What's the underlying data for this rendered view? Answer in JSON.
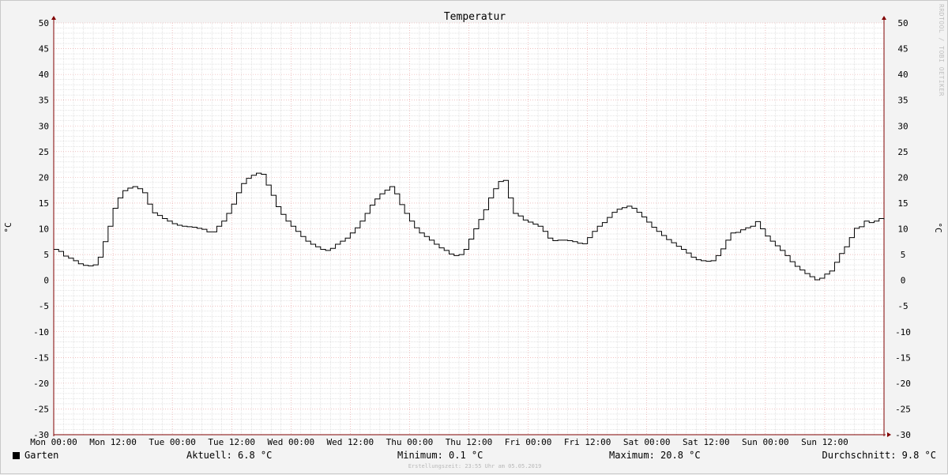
{
  "chart_data": {
    "type": "line",
    "style": "step",
    "title": "Temperatur",
    "ylabel": "°C",
    "ylim": [
      -30,
      50
    ],
    "yticks": [
      -30,
      -25,
      -20,
      -15,
      -10,
      -5,
      0,
      5,
      10,
      15,
      20,
      25,
      30,
      35,
      40,
      45,
      50
    ],
    "x_ticklabels": [
      "Mon 00:00",
      "Mon 12:00",
      "Tue 00:00",
      "Tue 12:00",
      "Wed 00:00",
      "Wed 12:00",
      "Thu 00:00",
      "Thu 12:00",
      "Fri 00:00",
      "Fri 12:00",
      "Sat 00:00",
      "Sat 12:00",
      "Sun 00:00",
      "Sun 12:00"
    ],
    "x_unit": "hours since Mon 00:00",
    "xlim": [
      0,
      168
    ],
    "grid": true,
    "series": [
      {
        "name": "Garten",
        "color": "#000000",
        "points": [
          [
            0,
            6.0
          ],
          [
            1,
            5.6
          ],
          [
            2,
            4.7
          ],
          [
            3,
            4.3
          ],
          [
            4,
            3.8
          ],
          [
            5,
            3.2
          ],
          [
            6,
            2.9
          ],
          [
            7,
            2.8
          ],
          [
            8,
            3.0
          ],
          [
            9,
            4.5
          ],
          [
            10,
            7.5
          ],
          [
            11,
            10.5
          ],
          [
            12,
            14.0
          ],
          [
            13,
            16.0
          ],
          [
            14,
            17.4
          ],
          [
            15,
            17.9
          ],
          [
            16,
            18.2
          ],
          [
            17,
            17.8
          ],
          [
            18,
            17.0
          ],
          [
            19,
            14.8
          ],
          [
            20,
            13.1
          ],
          [
            21,
            12.6
          ],
          [
            22,
            12.0
          ],
          [
            23,
            11.5
          ],
          [
            24,
            11.0
          ],
          [
            25,
            10.7
          ],
          [
            26,
            10.5
          ],
          [
            27,
            10.4
          ],
          [
            28,
            10.3
          ],
          [
            29,
            10.1
          ],
          [
            30,
            9.9
          ],
          [
            31,
            9.4
          ],
          [
            32,
            9.4
          ],
          [
            33,
            10.5
          ],
          [
            34,
            11.5
          ],
          [
            35,
            13.0
          ],
          [
            36,
            14.8
          ],
          [
            37,
            17.0
          ],
          [
            38,
            18.8
          ],
          [
            39,
            19.8
          ],
          [
            40,
            20.4
          ],
          [
            41,
            20.8
          ],
          [
            42,
            20.6
          ],
          [
            43,
            18.5
          ],
          [
            44,
            16.5
          ],
          [
            45,
            14.3
          ],
          [
            46,
            12.8
          ],
          [
            47,
            11.5
          ],
          [
            48,
            10.5
          ],
          [
            49,
            9.5
          ],
          [
            50,
            8.5
          ],
          [
            51,
            7.6
          ],
          [
            52,
            7.0
          ],
          [
            53,
            6.5
          ],
          [
            54,
            6.0
          ],
          [
            55,
            5.8
          ],
          [
            56,
            6.2
          ],
          [
            57,
            7.0
          ],
          [
            58,
            7.6
          ],
          [
            59,
            8.2
          ],
          [
            60,
            9.2
          ],
          [
            61,
            10.2
          ],
          [
            62,
            11.5
          ],
          [
            63,
            13.0
          ],
          [
            64,
            14.6
          ],
          [
            65,
            15.8
          ],
          [
            66,
            16.8
          ],
          [
            67,
            17.5
          ],
          [
            68,
            18.2
          ],
          [
            69,
            16.8
          ],
          [
            70,
            14.7
          ],
          [
            71,
            13.0
          ],
          [
            72,
            11.5
          ],
          [
            73,
            10.2
          ],
          [
            74,
            9.2
          ],
          [
            75,
            8.5
          ],
          [
            76,
            7.8
          ],
          [
            77,
            7.0
          ],
          [
            78,
            6.3
          ],
          [
            79,
            5.8
          ],
          [
            80,
            5.1
          ],
          [
            81,
            4.8
          ],
          [
            82,
            5.0
          ],
          [
            83,
            6.0
          ],
          [
            84,
            8.0
          ],
          [
            85,
            10.0
          ],
          [
            86,
            11.8
          ],
          [
            87,
            13.7
          ],
          [
            88,
            16.0
          ],
          [
            89,
            17.8
          ],
          [
            90,
            19.2
          ],
          [
            91,
            19.4
          ],
          [
            92,
            16.0
          ],
          [
            93,
            13.0
          ],
          [
            94,
            12.5
          ],
          [
            95,
            11.7
          ],
          [
            96,
            11.3
          ],
          [
            97,
            10.9
          ],
          [
            98,
            10.5
          ],
          [
            99,
            9.5
          ],
          [
            100,
            8.2
          ],
          [
            101,
            7.7
          ],
          [
            102,
            7.8
          ],
          [
            103,
            7.8
          ],
          [
            104,
            7.7
          ],
          [
            105,
            7.5
          ],
          [
            106,
            7.2
          ],
          [
            107,
            7.1
          ],
          [
            108,
            8.3
          ],
          [
            109,
            9.5
          ],
          [
            110,
            10.5
          ],
          [
            111,
            11.2
          ],
          [
            112,
            12.2
          ],
          [
            113,
            13.2
          ],
          [
            114,
            13.8
          ],
          [
            115,
            14.1
          ],
          [
            116,
            14.4
          ],
          [
            117,
            14.0
          ],
          [
            118,
            13.2
          ],
          [
            119,
            12.3
          ],
          [
            120,
            11.3
          ],
          [
            121,
            10.3
          ],
          [
            122,
            9.5
          ],
          [
            123,
            8.7
          ],
          [
            124,
            7.9
          ],
          [
            125,
            7.3
          ],
          [
            126,
            6.6
          ],
          [
            127,
            6.0
          ],
          [
            128,
            5.3
          ],
          [
            129,
            4.5
          ],
          [
            130,
            4.0
          ],
          [
            131,
            3.8
          ],
          [
            132,
            3.7
          ],
          [
            133,
            3.8
          ],
          [
            134,
            4.8
          ],
          [
            135,
            6.1
          ],
          [
            136,
            7.8
          ],
          [
            137,
            9.2
          ],
          [
            138,
            9.3
          ],
          [
            139,
            9.8
          ],
          [
            140,
            10.2
          ],
          [
            141,
            10.5
          ],
          [
            142,
            11.4
          ],
          [
            143,
            10.0
          ],
          [
            144,
            8.6
          ],
          [
            145,
            7.6
          ],
          [
            146,
            6.7
          ],
          [
            147,
            5.8
          ],
          [
            148,
            4.8
          ],
          [
            149,
            3.6
          ],
          [
            150,
            2.7
          ],
          [
            151,
            2.0
          ],
          [
            152,
            1.3
          ],
          [
            153,
            0.7
          ],
          [
            154,
            0.1
          ],
          [
            155,
            0.4
          ],
          [
            156,
            1.2
          ],
          [
            157,
            1.8
          ],
          [
            158,
            3.5
          ],
          [
            159,
            5.2
          ],
          [
            160,
            6.5
          ],
          [
            161,
            8.3
          ],
          [
            162,
            10.1
          ],
          [
            163,
            10.4
          ],
          [
            164,
            11.5
          ],
          [
            165,
            11.2
          ],
          [
            166,
            11.5
          ],
          [
            167,
            12.0
          ],
          [
            168,
            11.8
          ]
        ]
      }
    ]
  },
  "legend": {
    "series_name": "Garten",
    "current": "Aktuell: 6.8 °C",
    "minimum": "Minimum: 0.1 °C",
    "maximum": "Maximum: 20.8 °C",
    "average": "Durchschnitt: 9.8 °C"
  },
  "created": "Erstellungszeit: 23:55 Uhr am 05.05.2019",
  "watermark": "RRDTOOL / TOBI OETIKER",
  "colors": {
    "background": "#f3f3f3",
    "canvas": "#ffffff",
    "major_grid": "#e69a9a",
    "minor_grid": "#c8c8c8",
    "axis": "#800000",
    "line": "#000000"
  }
}
